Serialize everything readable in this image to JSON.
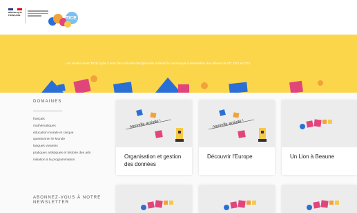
{
  "banner": {
    "text": "Les rendez-vous TICE cycle 2 sont des activités disciplinaires utilisant le numérique à destination des élèves de CP, CE1 et CE2.",
    "background": "#fcd64a"
  },
  "logo": {
    "text": "TICE"
  },
  "sidebar": {
    "domains_title": "DOMAINES",
    "domains": [
      "français",
      "mathématiques",
      "éducation morale et civique",
      "questionner le Monde",
      "langues vivantes",
      "pratiques artistiques et histoire des arts",
      "initiation à la programmation"
    ],
    "newsletter_title": "ABONNEZ-VOUS À NOTRE NEWSLETTER"
  },
  "cards": [
    {
      "title": "Organisation et gestion des données",
      "badge": "nouvelle activité !"
    },
    {
      "title": "Découvrir l'Europe",
      "badge": "nouvelle activité !"
    },
    {
      "title": "Un Lion à Beaune",
      "badge": ""
    }
  ],
  "colors": {
    "blue": "#2a6fd6",
    "pink": "#e0457b",
    "red": "#d43a4a",
    "orange": "#f2a23a",
    "yellow": "#fcd64a"
  }
}
